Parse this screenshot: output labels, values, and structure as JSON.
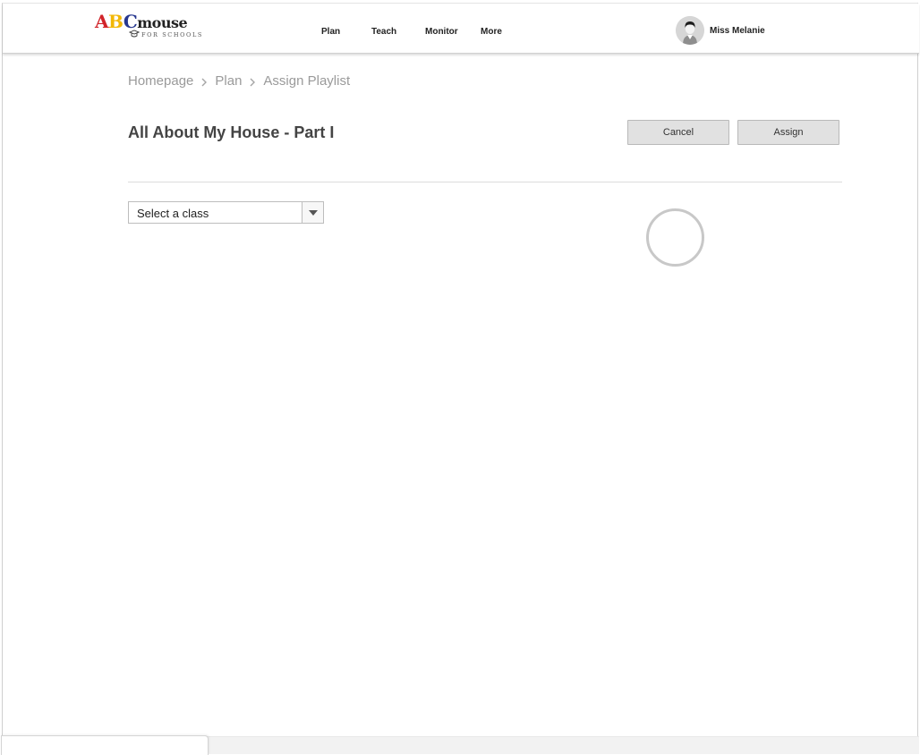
{
  "brand": {
    "logo_letters": [
      "A",
      "B",
      "C"
    ],
    "logo_word": "mouse",
    "logo_sub": "FOR SCHOOLS",
    "colors": {
      "a": "#d1242a",
      "b": "#f2b705",
      "c": "#27378f"
    }
  },
  "nav": {
    "items": [
      {
        "label": "Plan"
      },
      {
        "label": "Teach"
      },
      {
        "label": "Monitor"
      },
      {
        "label": "More"
      }
    ]
  },
  "user": {
    "name": "Miss Melanie",
    "avatar_icon": "user-avatar-icon"
  },
  "breadcrumb": {
    "items": [
      {
        "label": "Homepage"
      },
      {
        "label": "Plan"
      },
      {
        "label": "Assign Playlist"
      }
    ]
  },
  "page": {
    "title": "All About My House - Part I",
    "cancel_label": "Cancel",
    "assign_label": "Assign"
  },
  "class_select": {
    "selected": "Select a class",
    "arrow_icon": "caret-down-icon"
  },
  "loading": {
    "icon": "loading-spinner-icon"
  }
}
